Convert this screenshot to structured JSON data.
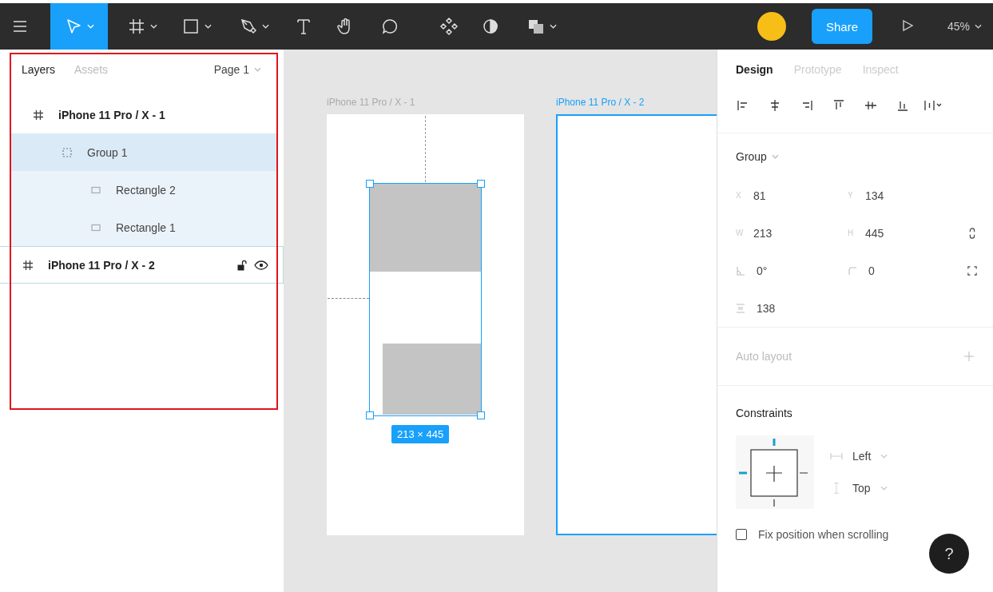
{
  "toolbar": {
    "tools": [
      {
        "kind": "menu",
        "selected": false,
        "dropdown": false
      },
      {
        "kind": "move",
        "selected": true,
        "dropdown": true
      },
      {
        "kind": "frame",
        "selected": false,
        "dropdown": true
      },
      {
        "kind": "rectangle",
        "selected": false,
        "dropdown": true
      },
      {
        "kind": "pen",
        "selected": false,
        "dropdown": true
      },
      {
        "kind": "text",
        "selected": false,
        "dropdown": false
      },
      {
        "kind": "hand",
        "selected": false,
        "dropdown": false
      },
      {
        "kind": "comment",
        "selected": false,
        "dropdown": false
      },
      {
        "kind": "component",
        "selected": false,
        "dropdown": false
      },
      {
        "kind": "mask",
        "selected": false,
        "dropdown": false
      },
      {
        "kind": "boolean",
        "selected": false,
        "dropdown": true
      }
    ],
    "share_button": "Share",
    "zoom": "45%"
  },
  "layers_panel": {
    "tabs": [
      {
        "label": "Layers",
        "selected": true
      },
      {
        "label": "Assets",
        "selected": false
      }
    ],
    "page": "Page 1",
    "layers": [
      {
        "kind": "frame",
        "name": "iPhone 11 Pro / X - 1",
        "selected": false,
        "hovered": false,
        "children": [
          {
            "kind": "group",
            "name": "Group 1",
            "selected": true,
            "hovered": false,
            "children": [
              {
                "kind": "rectangle",
                "name": "Rectangle 2",
                "selected": false,
                "hovered": false
              },
              {
                "kind": "rectangle",
                "name": "Rectangle 1",
                "selected": false,
                "hovered": false
              }
            ]
          }
        ]
      },
      {
        "kind": "frame",
        "name": "iPhone 11 Pro / X - 2",
        "selected": false,
        "hovered": true
      }
    ]
  },
  "canvas": {
    "frames": [
      {
        "label": "iPhone 11 Pro / X - 1",
        "selected": false
      },
      {
        "label": "iPhone 11 Pro / X - 2",
        "selected": true
      }
    ],
    "selection_size": "213 × 445"
  },
  "design_panel": {
    "tabs": [
      {
        "label": "Design",
        "selected": true
      },
      {
        "label": "Prototype",
        "selected": false
      },
      {
        "label": "Inspect",
        "selected": false
      }
    ],
    "layer_type": "Group",
    "property_rows": [
      {
        "fields": [
          {
            "kind": "letter",
            "label": "X",
            "value": "81"
          },
          {
            "kind": "letter",
            "label": "Y",
            "value": "134"
          }
        ]
      },
      {
        "fields": [
          {
            "kind": "letter",
            "label": "W",
            "value": "213"
          },
          {
            "kind": "letter",
            "label": "H",
            "value": "445"
          },
          {
            "kind": "constrain"
          }
        ]
      },
      {
        "fields": [
          {
            "kind": "rotation",
            "value": "0°"
          },
          {
            "kind": "radius",
            "value": "0"
          },
          {
            "kind": "corners"
          }
        ]
      },
      {
        "fields": [
          {
            "kind": "spacing",
            "value": "138"
          }
        ]
      }
    ],
    "auto_layout": "Auto layout",
    "constraints": {
      "title": "Constraints",
      "horizontal": "Left",
      "vertical": "Top"
    },
    "fix_position": {
      "label": "Fix position when scrolling",
      "checked": false
    }
  },
  "help_button": "?"
}
